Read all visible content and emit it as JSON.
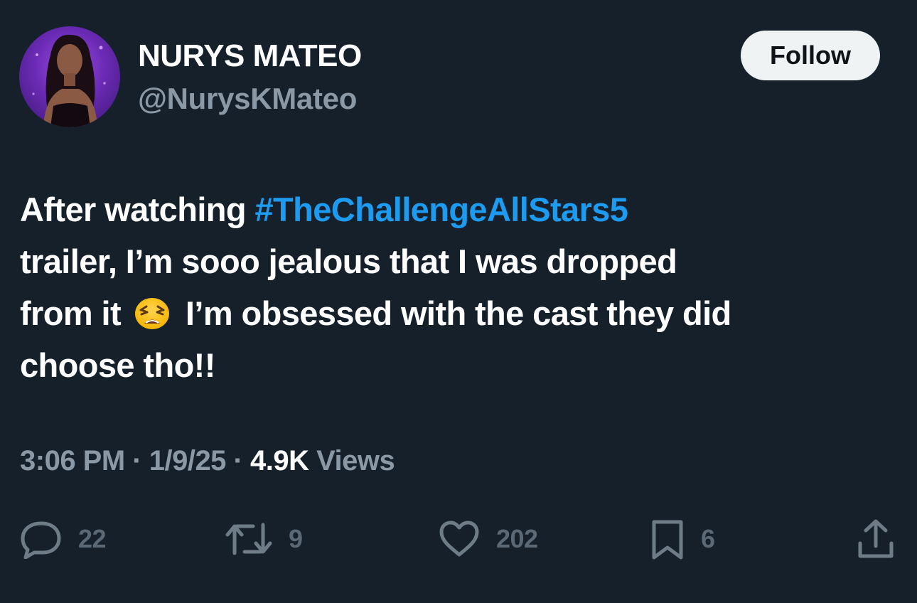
{
  "author": {
    "display_name": "NURYS MATEO",
    "handle": "@NurysKMateo"
  },
  "follow_label": "Follow",
  "tweet": {
    "text_line1_prefix": "After watching ",
    "hashtag": "#TheChallengeAllStars5",
    "text_line2": "trailer, I’m sooo jealous that I was dropped",
    "text_line3_prefix": "from it ",
    "emoji": "weary-face-emoji",
    "text_line3_suffix": " I’m obsessed with the cast they did",
    "text_line4": "choose tho!!"
  },
  "meta": {
    "time": "3:06 PM",
    "separator": " · ",
    "date": "1/9/25",
    "views_count": "4.9K",
    "views_label": " Views"
  },
  "actions": {
    "reply": {
      "icon": "reply-icon",
      "count": "22"
    },
    "retweet": {
      "icon": "retweet-icon",
      "count": "9"
    },
    "like": {
      "icon": "heart-icon",
      "count": "202"
    },
    "bookmark": {
      "icon": "bookmark-icon",
      "count": "6"
    },
    "share": {
      "icon": "share-icon"
    }
  },
  "colors": {
    "background": "#15202b",
    "hashtag": "#1d9bf0",
    "secondary_text": "#8b98a5",
    "follow_button_bg": "#eff3f4"
  }
}
